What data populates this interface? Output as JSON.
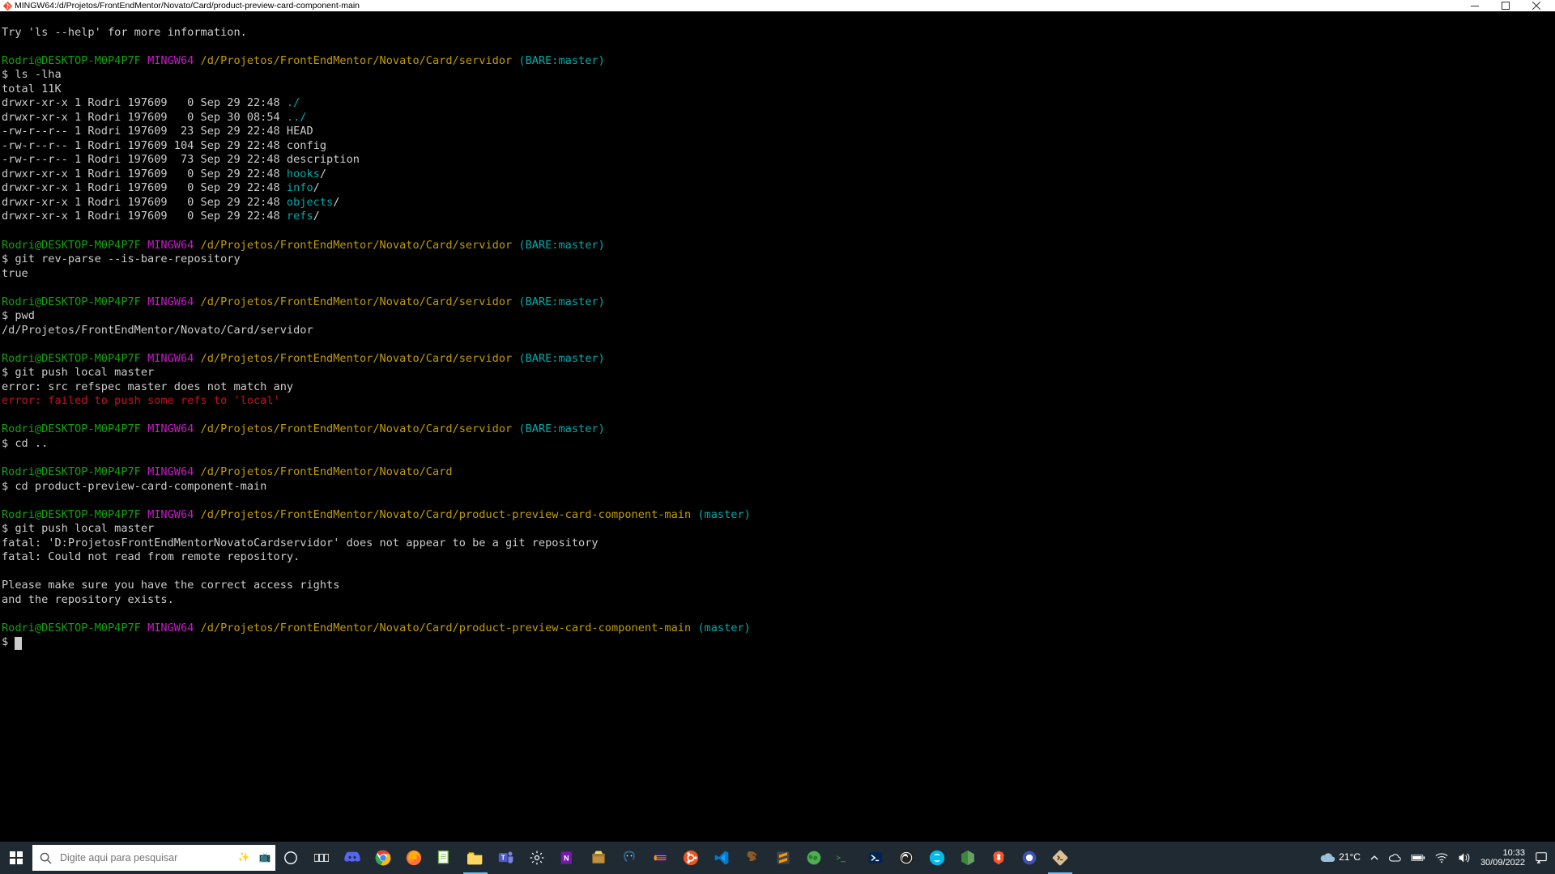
{
  "window": {
    "title": "MINGW64:/d/Projetos/FrontEndMentor/Novato/Card/product-preview-card-component-main"
  },
  "term": {
    "l0": "Try 'ls --help' for more information.",
    "user": "Rodri@DESKTOP-M0P4P7F",
    "mingw": "MINGW64",
    "path_serv": "/d/Projetos/FrontEndMentor/Novato/Card/servidor",
    "path_card": "/d/Projetos/FrontEndMentor/Novato/Card",
    "path_proj": "/d/Projetos/FrontEndMentor/Novato/Card/product-preview-card-component-main",
    "branch_bare": "(BARE:master)",
    "branch_master": "(master)",
    "cmd_ls": "$ ls -lha",
    "ls_total": "total 11K",
    "ls1_a": "drwxr-xr-x 1 Rodri 197609   0 Sep 29 22:48 ",
    "ls1_b": "./",
    "ls2_a": "drwxr-xr-x 1 Rodri 197609   0 Sep 30 08:54 ",
    "ls2_b": "../",
    "ls3": "-rw-r--r-- 1 Rodri 197609  23 Sep 29 22:48 HEAD",
    "ls4": "-rw-r--r-- 1 Rodri 197609 104 Sep 29 22:48 config",
    "ls5": "-rw-r--r-- 1 Rodri 197609  73 Sep 29 22:48 description",
    "ls6_a": "drwxr-xr-x 1 Rodri 197609   0 Sep 29 22:48 ",
    "ls6_b": "hooks",
    "ls7_a": "drwxr-xr-x 1 Rodri 197609   0 Sep 29 22:48 ",
    "ls7_b": "info",
    "ls8_a": "drwxr-xr-x 1 Rodri 197609   0 Sep 29 22:48 ",
    "ls8_b": "objects",
    "ls9_a": "drwxr-xr-x 1 Rodri 197609   0 Sep 29 22:48 ",
    "ls9_b": "refs",
    "slash": "/",
    "cmd_revparse": "$ git rev-parse --is-bare-repository",
    "out_true": "true",
    "cmd_pwd": "$ pwd",
    "out_pwd": "/d/Projetos/FrontEndMentor/Novato/Card/servidor",
    "cmd_push1": "$ git push local master",
    "err_refspec": "error: src refspec master does not match any",
    "err_push": "error: failed to push some refs to 'local'",
    "cmd_cdup": "$ cd ..",
    "cmd_cdproj": "$ cd product-preview-card-component-main",
    "cmd_push2": "$ git push local master",
    "fatal1": "fatal: 'D:ProjetosFrontEndMentorNovatoCardservidor' does not appear to be a git repository",
    "fatal2": "fatal: Could not read from remote repository.",
    "msg1": "Please make sure you have the correct access rights",
    "msg2": "and the repository exists.",
    "dollar": "$"
  },
  "taskbar": {
    "search_placeholder": "Digite aqui para pesquisar",
    "weather_temp": "21°C",
    "clock_time": "10:33",
    "clock_date": "30/09/2022"
  },
  "icons": {
    "start": "start-icon",
    "search": "search-icon",
    "deco1": "sparkle-icon",
    "deco2": "tv-icon",
    "cortana": "cortana-icon",
    "taskview": "taskview-icon"
  }
}
